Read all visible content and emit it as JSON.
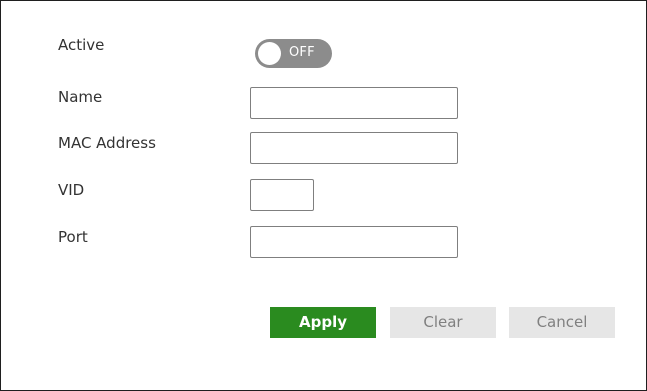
{
  "form": {
    "active": {
      "label": "Active",
      "toggle_state": "OFF"
    },
    "name": {
      "label": "Name",
      "value": "",
      "placeholder": ""
    },
    "mac_address": {
      "label": "MAC Address",
      "value": "",
      "placeholder": ""
    },
    "vid": {
      "label": "VID",
      "value": "",
      "placeholder": ""
    },
    "port": {
      "label": "Port",
      "value": "",
      "placeholder": ""
    }
  },
  "buttons": {
    "apply": "Apply",
    "clear": "Clear",
    "cancel": "Cancel"
  },
  "colors": {
    "apply_bg": "#2a8b1f",
    "secondary_bg": "#e6e6e6",
    "toggle_off_bg": "#8c8c8c"
  },
  "icons": {
    "toggle_knob": "toggle-knob-circle"
  }
}
